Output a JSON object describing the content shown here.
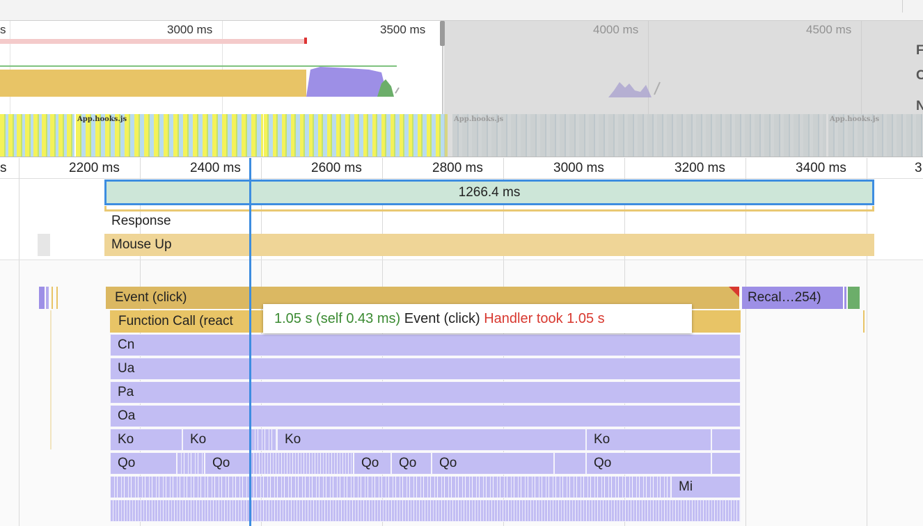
{
  "overview": {
    "ticks": [
      "s",
      "3000 ms",
      "3500 ms",
      "4000 ms",
      "4500 ms"
    ],
    "side_letters": [
      "F",
      "C",
      "N"
    ],
    "thumbnail_labels": [
      "App.hooks.js",
      "App.hooks.js",
      "App.hooks.js"
    ]
  },
  "ruler": {
    "ticks": [
      "s",
      "2200 ms",
      "2400 ms",
      "2600 ms",
      "2800 ms",
      "3000 ms",
      "3200 ms",
      "3400 ms",
      "3"
    ]
  },
  "interactions": {
    "duration": "1266.4 ms",
    "response_label": "Response",
    "mouse_up_label": "Mouse Up"
  },
  "flame": {
    "event": "Event (click)",
    "recalc": "Recal…254)",
    "function_call": "Function Call (react",
    "rows": [
      "Cn",
      "Ua",
      "Pa",
      "Oa"
    ],
    "ko": [
      "Ko",
      "Ko",
      "Ko",
      "Ko"
    ],
    "qo": [
      "Qo",
      "Qo",
      "Qo",
      "Qo",
      "Qo",
      "Qo"
    ],
    "mi": "Mi"
  },
  "tooltip": {
    "time": "1.05 s (self 0.43 ms)",
    "name": "Event (click)",
    "warning": "Handler took 1.05 s"
  },
  "colors": {
    "selection": "#3d8de0",
    "scripting": "#e8c466",
    "rendering": "#9d8fe6",
    "painting": "#6cae6a",
    "js_frames": "#c2bdf3",
    "warning": "#d8382f"
  }
}
